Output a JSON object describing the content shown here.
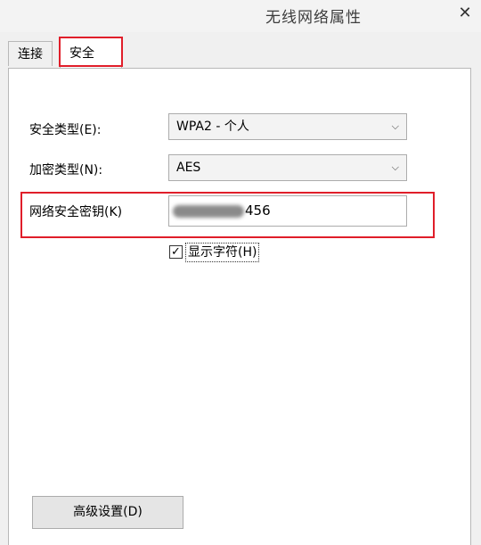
{
  "window": {
    "title": "无线网络属性",
    "close": "✕"
  },
  "tabs": [
    {
      "label": "连接"
    },
    {
      "label": "安全"
    }
  ],
  "security": {
    "type_label": "安全类型(E):",
    "type_value": "WPA2 - 个人",
    "encryption_label": "加密类型(N):",
    "encryption_value": "AES",
    "key_label": "网络安全密钥(K)",
    "key_visible_suffix": "456",
    "show_chars_label": "显示字符(H)",
    "show_chars_checked": "✓"
  },
  "buttons": {
    "advanced": "高级设置(D)"
  },
  "highlight_color": "#e01e2a"
}
